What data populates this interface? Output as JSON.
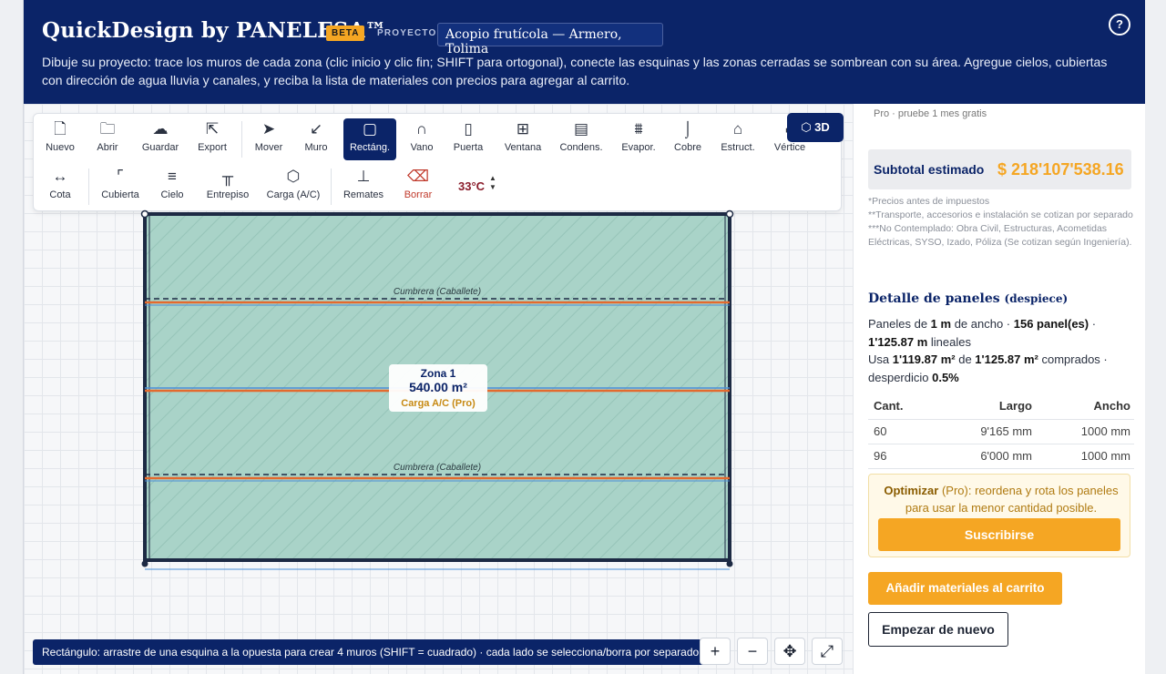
{
  "header": {
    "brand": "QuickDesign by PANELESA™",
    "badge": "BETA",
    "project_label": "PROYECTO",
    "project_name": "Acopio frutícola — Armero, Tolima",
    "help": "?",
    "intro": "Dibuje su proyecto: trace los muros de cada zona (clic inicio y clic fin; SHIFT para ortogonal), conecte las esquinas y las zonas cerradas se sombrean con su área. Agregue cielos, cubiertas con dirección de agua lluvia y canales, y reciba la lista de materiales con precios para agregar al carrito."
  },
  "toolbar": {
    "row1": [
      {
        "id": "nuevo",
        "label": "Nuevo",
        "icon": "file-icon",
        "glyph": "🗋"
      },
      {
        "id": "abrir",
        "label": "Abrir",
        "icon": "folder-icon",
        "glyph": "🗀"
      },
      {
        "id": "guardar",
        "label": "Guardar",
        "icon": "cloud-upload-icon",
        "glyph": "☁"
      },
      {
        "id": "exportar",
        "label": "Export",
        "icon": "export-icon",
        "glyph": "⇱"
      },
      {
        "id": "mover",
        "label": "Mover",
        "icon": "cursor-icon",
        "glyph": "➤"
      },
      {
        "id": "muro",
        "label": "Muro",
        "icon": "diagonal-line-icon",
        "glyph": "↙"
      },
      {
        "id": "rect",
        "label": "Rectáng.",
        "icon": "square-icon",
        "glyph": "▢"
      },
      {
        "id": "vano",
        "label": "Vano",
        "icon": "arch-icon",
        "glyph": "∩"
      },
      {
        "id": "puerta",
        "label": "Puerta",
        "icon": "door-icon",
        "glyph": "▯"
      },
      {
        "id": "ventana",
        "label": "Ventana",
        "icon": "window-icon",
        "glyph": "⊞"
      },
      {
        "id": "condens",
        "label": "Condens.",
        "icon": "condenser-icon",
        "glyph": "▤"
      },
      {
        "id": "evapor",
        "label": "Evapor.",
        "icon": "evaporator-icon",
        "glyph": "⩩"
      },
      {
        "id": "cobre",
        "label": "Cobre",
        "icon": "pipe-icon",
        "glyph": "⌡"
      },
      {
        "id": "estruct",
        "label": "Estruct.",
        "icon": "structure-icon",
        "glyph": "⌂"
      },
      {
        "id": "vertice",
        "label": "Vértice",
        "icon": "vertex-icon",
        "glyph": "⌐"
      }
    ],
    "row2": [
      {
        "id": "cota",
        "label": "Cota",
        "icon": "dimension-icon",
        "glyph": "↔"
      },
      {
        "id": "cubierta",
        "label": "Cubierta",
        "icon": "roof-icon",
        "glyph": "⌜"
      },
      {
        "id": "cielo",
        "label": "Cielo",
        "icon": "ceiling-icon",
        "glyph": "≡"
      },
      {
        "id": "entrepiso",
        "label": "Entrepiso",
        "icon": "mezzanine-icon",
        "glyph": "╥"
      },
      {
        "id": "carga",
        "label": "Carga (A/C)",
        "icon": "cube-icon",
        "glyph": "⬡"
      },
      {
        "id": "remates",
        "label": "Remates",
        "icon": "trim-icon",
        "glyph": "⊥"
      },
      {
        "id": "borrar",
        "label": "Borrar",
        "icon": "eraser-icon",
        "glyph": "⌫"
      }
    ],
    "temperature": "33°C",
    "view3d": "3D"
  },
  "drawing": {
    "zone_name": "Zona 1",
    "zone_area": "540.00 m²",
    "zone_load": "Carga A/C (Pro)",
    "ridge_label": "Cumbrera (Caballete)"
  },
  "status_bar": "Rectángulo: arrastre de una esquina a la opuesta para crear 4 muros (SHIFT = cuadrado) · cada lado se selecciona/borra por separado",
  "zoom": {
    "in": "+",
    "out": "−",
    "pan": "✥",
    "fit": "⤢"
  },
  "sidebar": {
    "pro_note": "Pro · pruebe 1 mes gratis",
    "subtotal_label": "Subtotal estimado",
    "subtotal_value": "$ 218'107'538.16",
    "notes": [
      "*Precios antes de impuestos",
      "**Transporte, accesorios e instalación se cotizan por separado",
      "***No Contemplado: Obra Civil, Estructuras, Acometidas Eléctricas, SYSO, Izado, Póliza (Se cotizan según Ingeniería)."
    ],
    "detail_title": "Detalle de paneles",
    "detail_sub": "(despiece)",
    "detail": {
      "p1": "Paneles de ",
      "width": "1 m",
      "p2": " de ancho · ",
      "count": "156 panel(es)",
      "p3": " · ",
      "linear": "1'125.87 m",
      "p4": " lineales",
      "p5": "Usa ",
      "used": "1'119.87 m²",
      "p6": " de ",
      "bought": "1'125.87 m²",
      "p7": " comprados · desperdicio ",
      "waste": "0.5%"
    },
    "table": {
      "headers": [
        "Cant.",
        "Largo",
        "Ancho"
      ],
      "rows": [
        [
          "60",
          "9'165 mm",
          "1000 mm"
        ],
        [
          "96",
          "6'000 mm",
          "1000 mm"
        ]
      ]
    },
    "optimize_label": "Optimizar",
    "optimize_text": " (Pro): reordena y rota los paneles para usar la menor cantidad posible.",
    "subscribe": "Suscribirse",
    "add_cart": "Añadir materiales al carrito",
    "reset": "Empezar de nuevo"
  }
}
